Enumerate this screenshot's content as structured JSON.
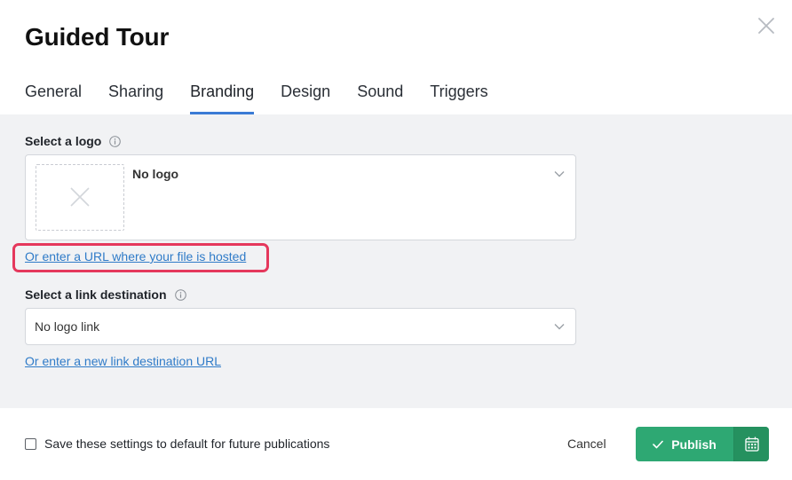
{
  "dialog": {
    "title": "Guided Tour",
    "close_icon": "close-icon"
  },
  "tabs": [
    {
      "label": "General"
    },
    {
      "label": "Sharing"
    },
    {
      "label": "Branding",
      "active": true
    },
    {
      "label": "Design"
    },
    {
      "label": "Sound"
    },
    {
      "label": "Triggers"
    }
  ],
  "logo": {
    "label": "Select a logo",
    "info_icon": "info-icon",
    "selected": "No logo",
    "placeholder_icon": "x-placeholder-icon",
    "url_link": "Or enter a URL where your file is hosted"
  },
  "destination": {
    "label": "Select a link destination",
    "info_icon": "info-icon",
    "selected": "No logo link",
    "url_link": "Or enter a new link destination URL"
  },
  "footer": {
    "save_default_label": "Save these settings to default for future publications",
    "save_default_checked": false,
    "cancel_label": "Cancel",
    "publish_label": "Publish",
    "schedule_icon": "calendar-icon"
  },
  "colors": {
    "accent": "#3a7bd5",
    "link": "#2f7bc8",
    "publish": "#2ea873",
    "highlight": "#e5385c",
    "panel_bg": "#f1f2f4"
  }
}
